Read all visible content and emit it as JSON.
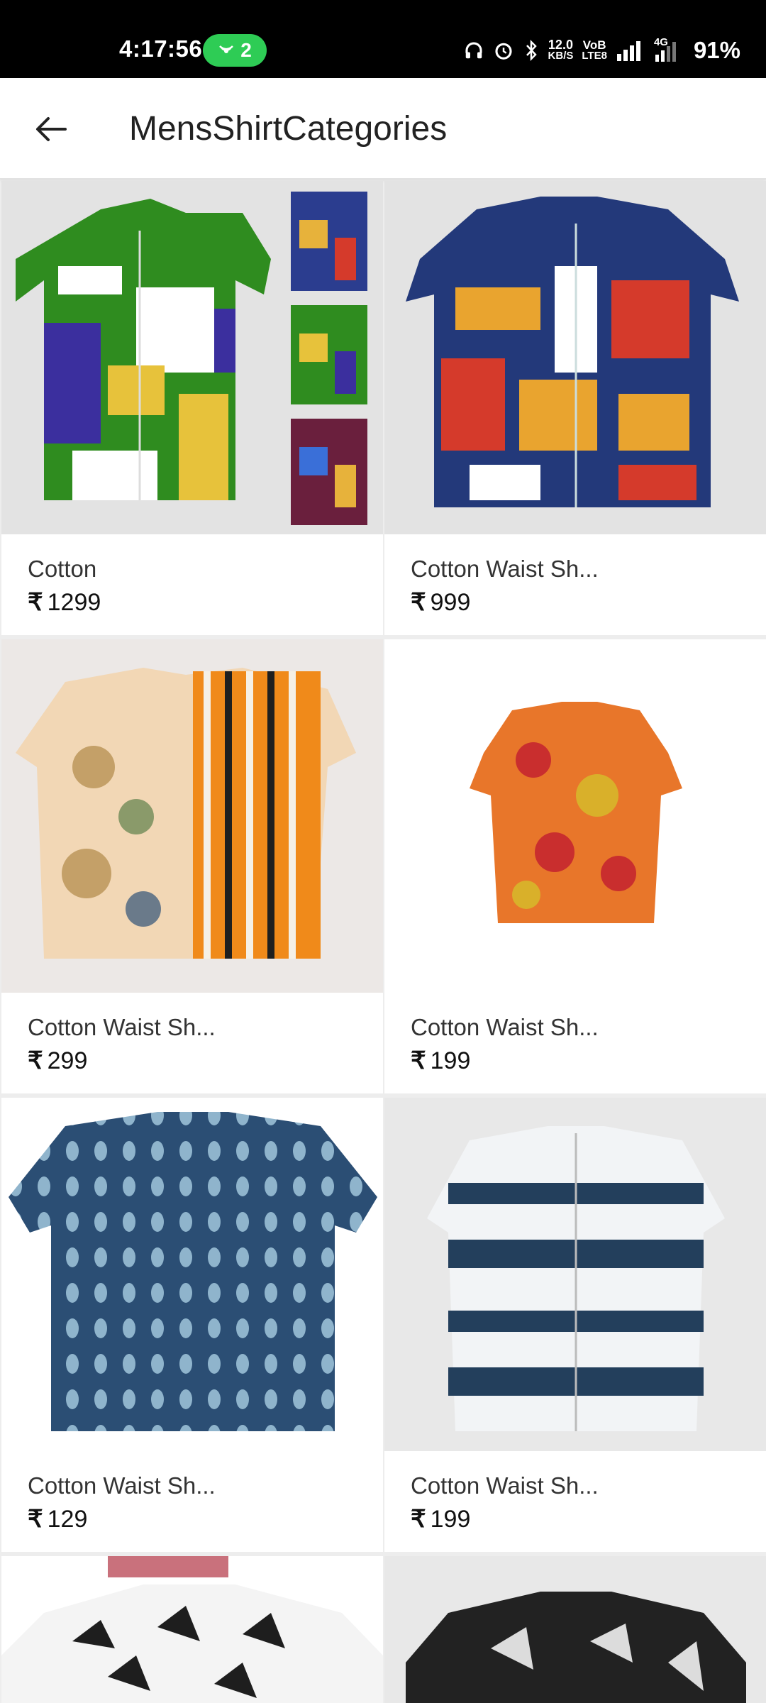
{
  "status_bar": {
    "time": "4:17:56",
    "hotspot_count": "2",
    "network_speed_value": "12.0",
    "network_speed_unit": "KB/S",
    "volte_top": "VoB",
    "volte_bottom": "LTE8",
    "network_type": "4G",
    "battery": "91%"
  },
  "app_bar": {
    "title": "MensShirtCategories"
  },
  "currency_symbol": "₹",
  "products": [
    {
      "name": "Cotton",
      "price": "1299"
    },
    {
      "name": "Cotton Waist Sh...",
      "price": "999"
    },
    {
      "name": "Cotton Waist Sh...",
      "price": "299"
    },
    {
      "name": "Cotton Waist Sh...",
      "price": "199"
    },
    {
      "name": "Cotton Waist Sh...",
      "price": "129"
    },
    {
      "name": "Cotton Waist Sh...",
      "price": "199"
    }
  ]
}
